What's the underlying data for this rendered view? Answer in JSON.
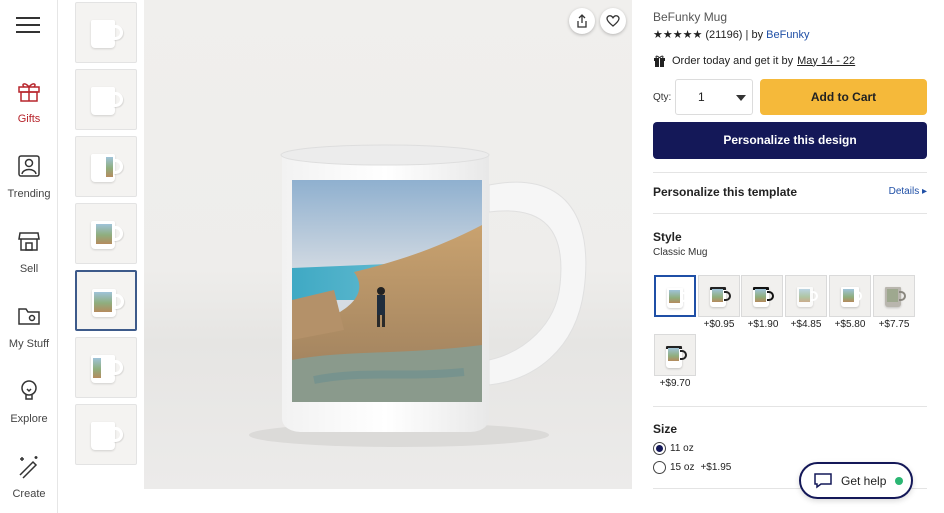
{
  "nav": {
    "items": [
      {
        "label": "Gifts",
        "icon": "gift-icon"
      },
      {
        "label": "Trending",
        "icon": "trending-icon"
      },
      {
        "label": "Sell",
        "icon": "store-icon"
      },
      {
        "label": "My Stuff",
        "icon": "folder-icon"
      },
      {
        "label": "Explore",
        "icon": "lightbulb-icon"
      },
      {
        "label": "Create",
        "icon": "magic-wand-icon"
      }
    ],
    "active_color": "#b7252c"
  },
  "product": {
    "title": "BeFunky Mug",
    "stars": "★★★★★",
    "review_count": "(21196)",
    "by_label": "| by",
    "brand": "BeFunky",
    "order_text": "Order today and get it by",
    "delivery_date": "May 14 - 22",
    "qty_label": "Qty:",
    "qty_value": "1",
    "add_to_cart": "Add to Cart",
    "personalize": "Personalize this design"
  },
  "template": {
    "title": "Personalize this template",
    "details": "Details ▸"
  },
  "style": {
    "title": "Style",
    "selected": "Classic Mug",
    "options": [
      {
        "price": "",
        "variant": "classic"
      },
      {
        "price": "+$0.95",
        "variant": "black-rim"
      },
      {
        "price": "+$1.90",
        "variant": "black-inner"
      },
      {
        "price": "+$4.85",
        "variant": "frosted"
      },
      {
        "price": "+$5.80",
        "variant": "white-large"
      },
      {
        "price": "+$7.75",
        "variant": "stein"
      },
      {
        "price": "+$9.70",
        "variant": "travel"
      }
    ]
  },
  "size": {
    "title": "Size",
    "options": [
      {
        "label": "11 oz",
        "extra": "",
        "selected": true
      },
      {
        "label": "15 oz",
        "extra": "+$1.95",
        "selected": false
      }
    ]
  },
  "help": {
    "label": "Get help"
  },
  "colors": {
    "primary": "#141858",
    "cart": "#f5b93a",
    "link": "#1f4fa6",
    "online": "#2bb673"
  }
}
